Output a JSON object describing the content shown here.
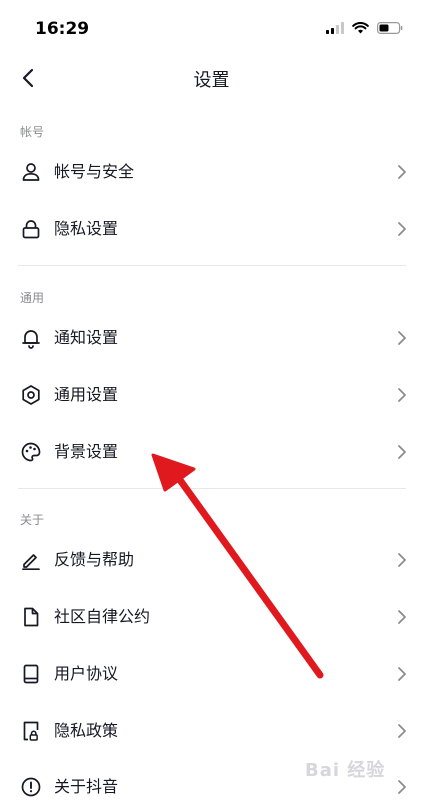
{
  "status_bar": {
    "time": "16:29",
    "icons": [
      "signal-icon",
      "wifi-icon",
      "battery-icon"
    ]
  },
  "nav": {
    "title": "设置",
    "back_icon": "chevron-left-icon"
  },
  "sections": [
    {
      "header": "帐号",
      "items": [
        {
          "label": "帐号与安全",
          "icon": "user-icon"
        },
        {
          "label": "隐私设置",
          "icon": "lock-icon"
        }
      ]
    },
    {
      "header": "通用",
      "items": [
        {
          "label": "通知设置",
          "icon": "bell-icon"
        },
        {
          "label": "通用设置",
          "icon": "gear-icon"
        },
        {
          "label": "背景设置",
          "icon": "palette-icon"
        }
      ]
    },
    {
      "header": "关于",
      "items": [
        {
          "label": "反馈与帮助",
          "icon": "pen-icon"
        },
        {
          "label": "社区自律公约",
          "icon": "document-icon"
        },
        {
          "label": "用户协议",
          "icon": "book-icon"
        },
        {
          "label": "隐私政策",
          "icon": "privacy-doc-icon"
        },
        {
          "label": "关于抖音",
          "icon": "info-icon"
        }
      ]
    }
  ],
  "annotation": {
    "arrow_color": "#e0191e"
  },
  "watermark": {
    "text": "Bai 经验"
  },
  "colors": {
    "text": "#161823",
    "section_header": "#8a8b91",
    "divider": "#e8e8ea",
    "chevron": "#8a8b91"
  }
}
